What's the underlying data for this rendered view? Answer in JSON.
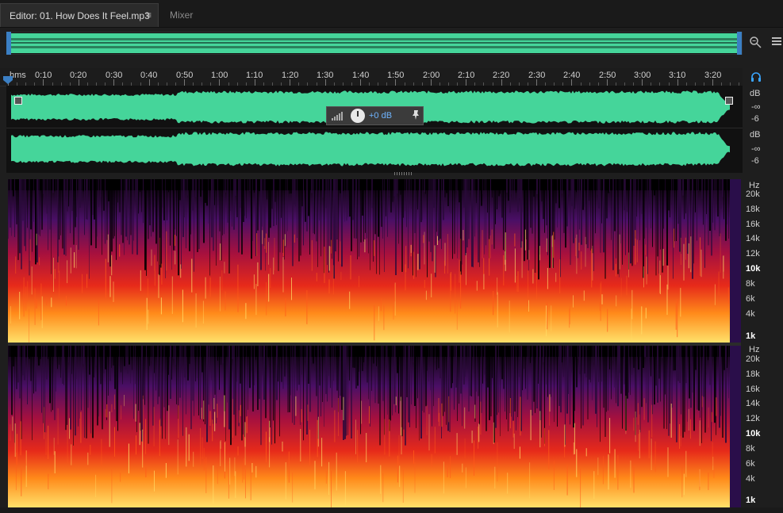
{
  "tabs": {
    "editor_label": "Editor: 01. How Does It Feel.mp3",
    "editor_menu": "≡",
    "mixer_label": "Mixer"
  },
  "icons": {
    "zoom": "zoom-selection-icon",
    "panel": "panel-menu-icon",
    "headphones": "headphones-icon",
    "pin": "pin-icon"
  },
  "ruler": {
    "unit": "hms",
    "labels": [
      "0:10",
      "0:20",
      "0:30",
      "0:40",
      "0:50",
      "1:00",
      "1:10",
      "1:20",
      "1:30",
      "1:40",
      "1:50",
      "2:00",
      "2:10",
      "2:20",
      "2:30",
      "2:40",
      "2:50",
      "3:00",
      "3:10",
      "3:20"
    ]
  },
  "hud": {
    "gain": "+0 dB"
  },
  "amplitude_scale": {
    "left": [
      "dB",
      "-∞",
      "-6"
    ],
    "right": [
      "dB",
      "-∞",
      "-6"
    ]
  },
  "frequency_scale": {
    "unit": "Hz",
    "labels": [
      "20k",
      "18k",
      "16k",
      "14k",
      "12k",
      "10k",
      "8k",
      "6k",
      "4k",
      "1k"
    ],
    "bold": [
      "10k",
      "1k"
    ]
  },
  "colors": {
    "waveform": "#45d59a",
    "accent": "#3b7fc4",
    "hud_value": "#6fb4ff"
  }
}
